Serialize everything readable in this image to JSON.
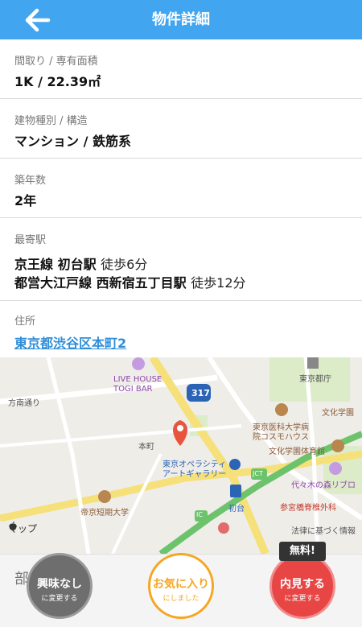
{
  "header": {
    "title": "物件詳細",
    "back_icon": "arrow-left-icon"
  },
  "rows": {
    "layout": {
      "label": "間取り / 専有面積",
      "value": "1K / 22.39㎡"
    },
    "building": {
      "label": "建物種別 / 構造",
      "value": "マンション / 鉄筋系"
    },
    "age": {
      "label": "築年数",
      "value": "2年"
    },
    "station": {
      "label": "最寄駅",
      "lines": [
        {
          "name": "京王線 初台駅",
          "walk": "徒歩6分"
        },
        {
          "name": "都営大江戸線 西新宿五丁目駅",
          "walk": "徒歩12分"
        }
      ]
    },
    "address": {
      "label": "住所",
      "value": "東京都渋谷区本町2"
    }
  },
  "map": {
    "labels": {
      "livehouse1": "LIVE HOUSE",
      "livehouse2": "TOGI BAR",
      "hokatsu": "方南通り",
      "honmachi": "本町",
      "route": "317",
      "tokyo_tocho": "東京都庁",
      "bunka1": "文化学園",
      "tmd1": "東京医科大学病",
      "tmd2": "院コスモハウス",
      "bunka_gym": "文化学園体育館",
      "opera1": "東京オペラシティ",
      "opera2": "アートギャラリー",
      "jct": "JCT",
      "yoyogi": "代々木の森リブロ",
      "teikyo": "帝京短期大学",
      "hatsudai": "初台",
      "ic": "IC",
      "sangubashi": "参宮橋脊椎外科",
      "houritsu": "法律に基づく情報"
    },
    "attribution": "マップ"
  },
  "bottom": {
    "section_title": "部屋・設備",
    "buttons": {
      "interest": {
        "main": "興味なし",
        "sub": "に変更する"
      },
      "favorite": {
        "main": "お気に入り",
        "sub": "にしました"
      },
      "view": {
        "main": "内見する",
        "sub": "に変更する"
      }
    },
    "free_badge": "無料!"
  }
}
